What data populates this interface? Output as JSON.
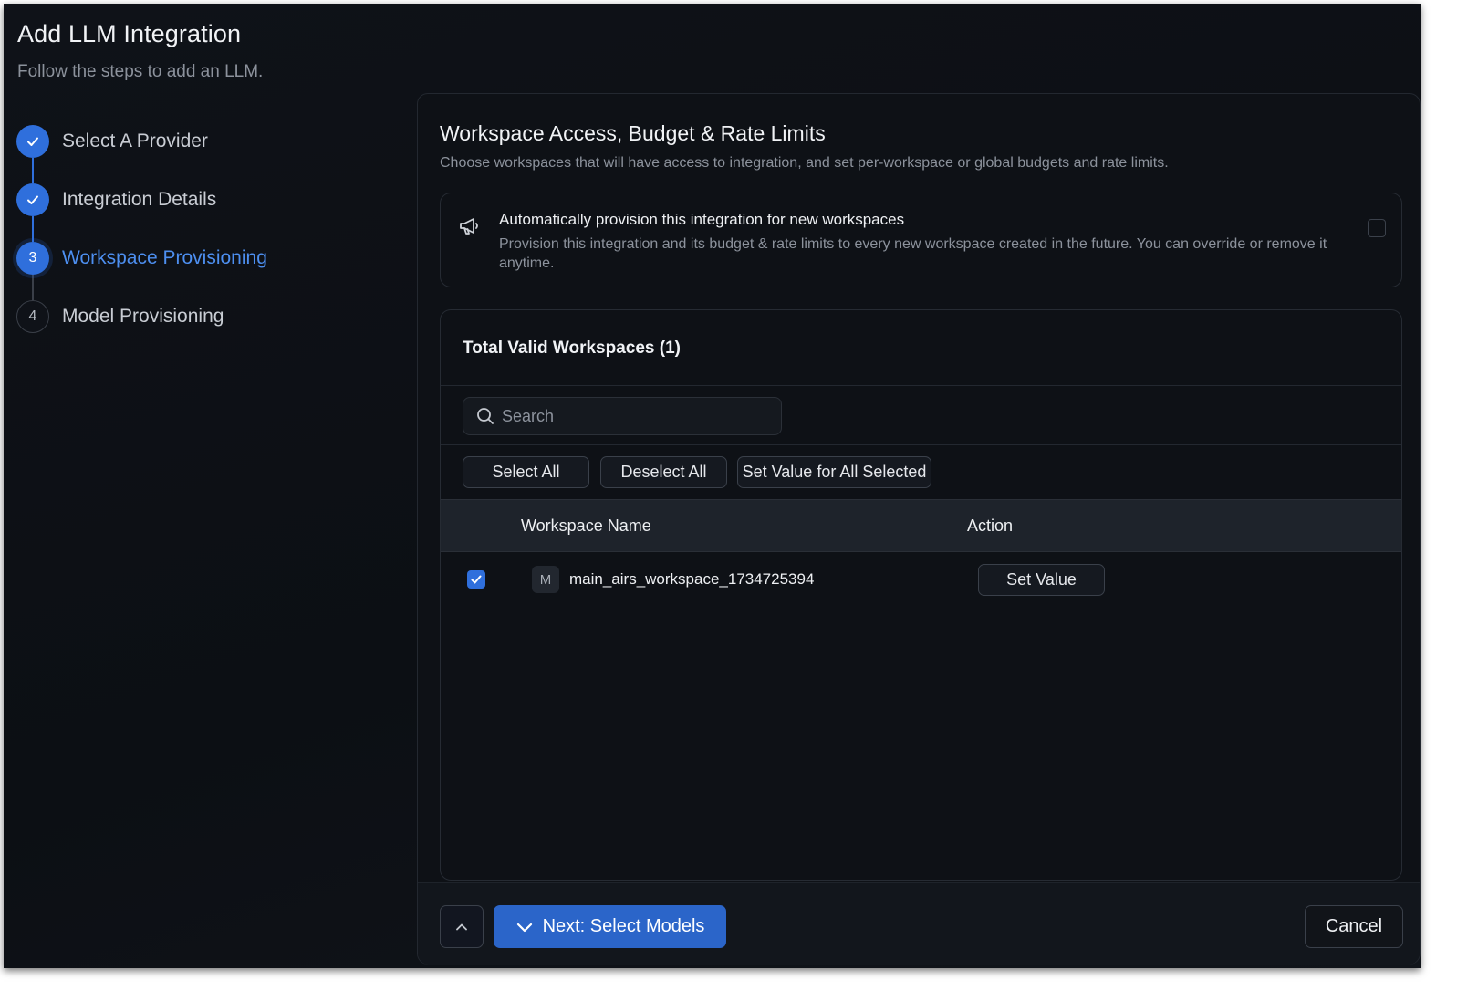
{
  "page": {
    "title": "Add LLM Integration",
    "subtitle": "Follow the steps to add an LLM."
  },
  "steps": [
    {
      "label": "Select A Provider",
      "status": "done",
      "number": "1"
    },
    {
      "label": "Integration Details",
      "status": "done",
      "number": "2"
    },
    {
      "label": "Workspace Provisioning",
      "status": "active",
      "number": "3"
    },
    {
      "label": "Model Provisioning",
      "status": "todo",
      "number": "4"
    }
  ],
  "section": {
    "title": "Workspace Access, Budget & Rate Limits",
    "description": "Choose workspaces that will have access to integration, and set per-workspace or global budgets and rate limits."
  },
  "auto_provision": {
    "icon": "megaphone-icon",
    "title": "Automatically provision this integration for new workspaces",
    "description": "Provision this integration and its budget & rate limits to every new workspace created in the future. You can override or remove it anytime.",
    "checked": false
  },
  "workspaces": {
    "title": "Total Valid Workspaces (1)",
    "search_placeholder": "Search",
    "select_all": "Select All",
    "deselect_all": "Deselect All",
    "set_value_all": "Set Value for All Selected",
    "columns": {
      "name": "Workspace Name",
      "action": "Action"
    },
    "rows": [
      {
        "checked": true,
        "avatar": "M",
        "name": "main_airs_workspace_1734725394",
        "action": "Set Value"
      }
    ]
  },
  "footer": {
    "next_label": "Next: Select Models",
    "cancel_label": "Cancel"
  },
  "colors": {
    "accent": "#2f6fdc",
    "active_step_text": "#4d8ff0",
    "background": "#0f1218"
  }
}
